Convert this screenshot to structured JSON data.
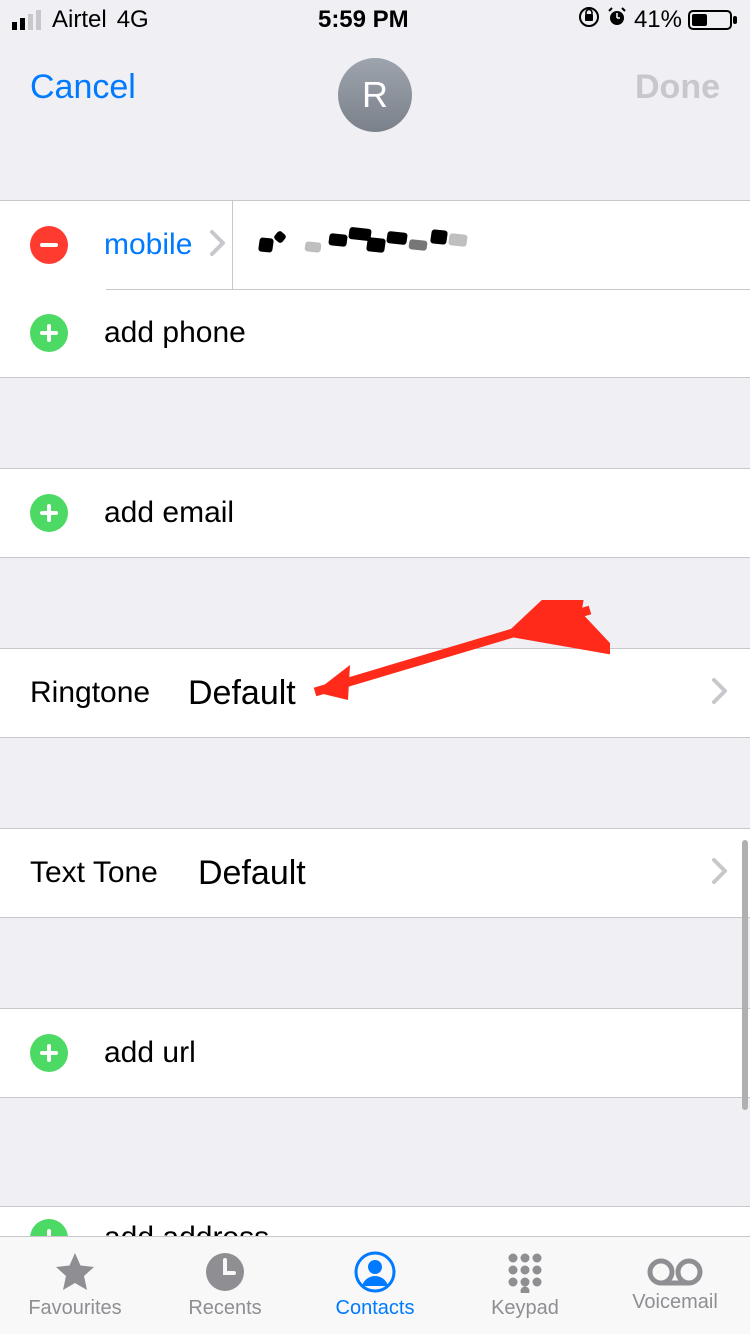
{
  "status": {
    "carrier": "Airtel",
    "network": "4G",
    "time": "5:59 PM",
    "battery_pct": "41%"
  },
  "nav": {
    "cancel": "Cancel",
    "done": "Done",
    "avatar_initial": "R"
  },
  "phone": {
    "type_label": "mobile",
    "add_label": "add phone"
  },
  "email": {
    "add_label": "add email"
  },
  "ringtone": {
    "label": "Ringtone",
    "value": "Default"
  },
  "texttone": {
    "label": "Text Tone",
    "value": "Default"
  },
  "url": {
    "add_label": "add url"
  },
  "address": {
    "add_label": "add address"
  },
  "tabs": {
    "favourites": "Favourites",
    "recents": "Recents",
    "contacts": "Contacts",
    "keypad": "Keypad",
    "voicemail": "Voicemail"
  }
}
